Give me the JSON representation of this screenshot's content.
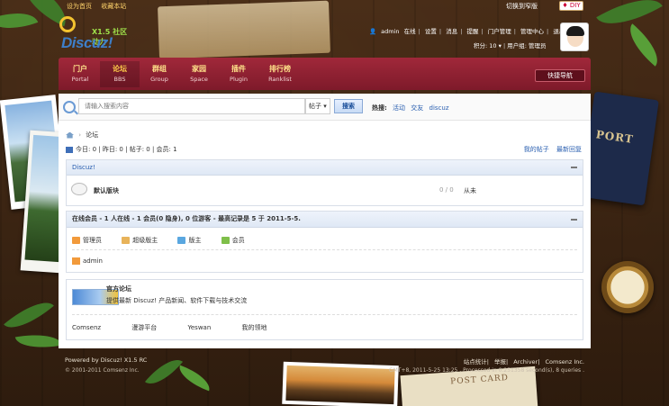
{
  "topbar": {
    "set_home": "设为首页",
    "bookmark": "收藏本站",
    "switch_style": "切换到窄版",
    "diy": "♦ DIY"
  },
  "logo": {
    "text": "Discuz!",
    "sub": "X1.5 社区动力"
  },
  "user": {
    "name": "admin",
    "links": [
      "在线",
      "设置",
      "消息",
      "提醒",
      "门户管理",
      "管理中心",
      "退出"
    ],
    "credits": "积分: 10 ▾",
    "group": "用户组: 管理员"
  },
  "nav": {
    "items": [
      {
        "cn": "门户",
        "en": "Portal"
      },
      {
        "cn": "论坛",
        "en": "BBS"
      },
      {
        "cn": "群组",
        "en": "Group"
      },
      {
        "cn": "家园",
        "en": "Space"
      },
      {
        "cn": "插件",
        "en": "Plugin"
      },
      {
        "cn": "排行榜",
        "en": "Ranklist"
      }
    ],
    "quick": "快捷导航"
  },
  "search": {
    "placeholder": "请输入搜索内容",
    "type": "帖子",
    "button": "搜索",
    "hot_label": "热搜:",
    "hot": [
      "活动",
      "交友",
      "discuz"
    ]
  },
  "breadcrumb": {
    "current": "论坛"
  },
  "stats": {
    "text": "今日: 0 | 昨日: 0 | 帖子: 0 | 会员: 1",
    "links": [
      "我的帖子",
      "最新回复"
    ]
  },
  "forum_group": {
    "title": "Discuz!",
    "forum_name": "默认版块",
    "count": "0 / 0",
    "last": "从未"
  },
  "online": {
    "title": "在线会员 - 1 人在线 - 1 会员(0 隐身), 0 位游客 - 最高记录是 5 于 2011-5-5.",
    "legend": [
      {
        "label": "管理员",
        "color": "#f29a3b"
      },
      {
        "label": "超级版主",
        "color": "#e8b35a"
      },
      {
        "label": "版主",
        "color": "#5aa7e0"
      },
      {
        "label": "会员",
        "color": "#7fbf4a"
      }
    ],
    "user": "admin"
  },
  "friendlinks": {
    "title": "官方论坛",
    "desc": "提供最新 Discuz! 产品新闻、软件下载与技术交流",
    "links": [
      "Comsenz",
      "漫游平台",
      "Yeswan",
      "我的领地"
    ]
  },
  "footer": {
    "powered": "Powered by Discuz! X1.5 RC",
    "copyright": "© 2001-2011 Comsenz Inc.",
    "links": [
      "站点统计",
      "举报",
      "Archiver",
      "Comsenz Inc."
    ],
    "info": "GMT+8, 2011-5-25 13:25 , Processed in 0.251358 second(s), 8 queries ."
  }
}
